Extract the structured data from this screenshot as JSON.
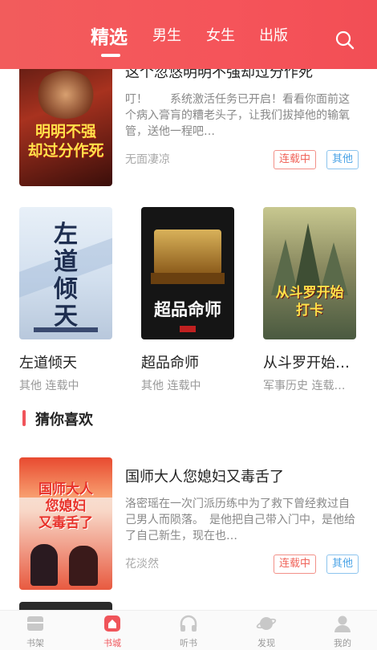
{
  "header": {
    "tabs": [
      {
        "label": "精选",
        "active": true
      },
      {
        "label": "男生",
        "active": false
      },
      {
        "label": "女生",
        "active": false
      },
      {
        "label": "出版",
        "active": false
      }
    ]
  },
  "featured_top": {
    "title": "这个忽悠明明不强却过分作死",
    "desc": "叮！　　系统激活任务已开启！看看你面前这个病入膏肓的糟老头子，让我们拔掉他的输氧管，送他一程吧…",
    "author": "无面凄凉",
    "status_tag": "连载中",
    "category_tag": "其他",
    "cover_text": "明明不强却过分作死"
  },
  "grid": [
    {
      "title": "左道倾天",
      "meta": "其他 连载中",
      "cover_text": "左道倾天"
    },
    {
      "title": "超品命师",
      "meta": "其他 连载中",
      "cover_text": "超品命师"
    },
    {
      "title": "从斗罗开始…",
      "meta": "军事历史 连载…",
      "cover_text": "从斗罗开始打卡"
    }
  ],
  "section": {
    "title": "猜你喜欢"
  },
  "recommend": {
    "title": "国师大人您媳妇又毒舌了",
    "desc": "洛密瑶在一次门派历练中为了救下曾经救过自己男人而陨落。　是他把自己带入门中，是他给了自己新生，现在也…",
    "author": "花淡然",
    "status_tag": "连载中",
    "category_tag": "其他",
    "cover_text": "国师大人您媳妇又毒舌了"
  },
  "bottom_nav": [
    {
      "label": "书架",
      "icon": "bookshelf-icon",
      "active": false
    },
    {
      "label": "书城",
      "icon": "bookstore-icon",
      "active": true
    },
    {
      "label": "听书",
      "icon": "headphones-icon",
      "active": false
    },
    {
      "label": "发现",
      "icon": "planet-icon",
      "active": false
    },
    {
      "label": "我的",
      "icon": "user-icon",
      "active": false
    }
  ],
  "colors": {
    "accent": "#f0545a",
    "tag_red": "#f0645a",
    "tag_blue": "#4aa3e6"
  }
}
